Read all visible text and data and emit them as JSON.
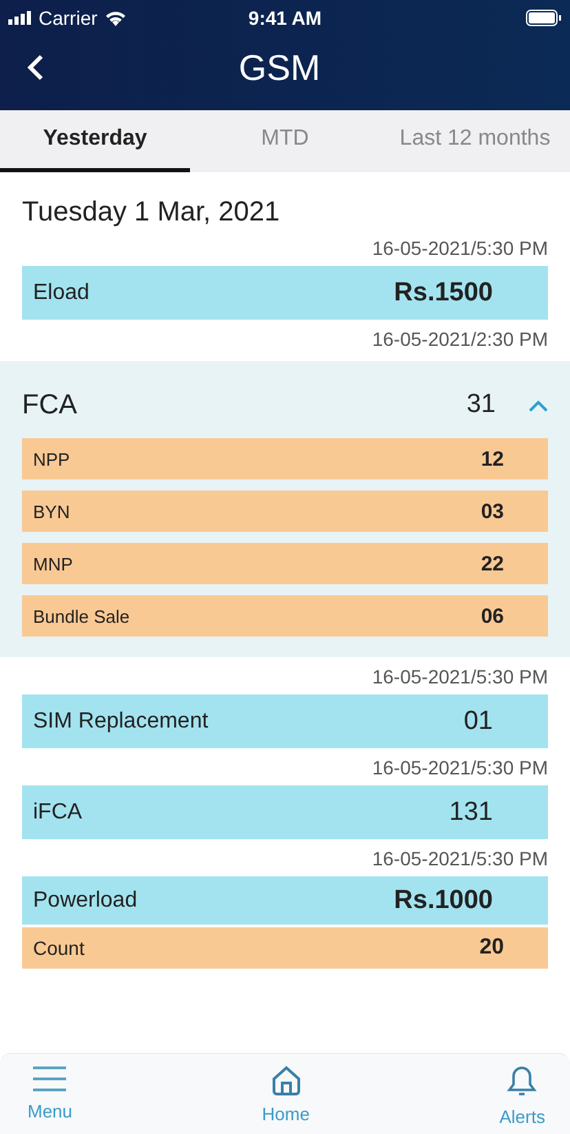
{
  "status_bar": {
    "carrier": "Carrier",
    "time": "9:41 AM"
  },
  "header": {
    "title": "GSM"
  },
  "tabs": [
    {
      "label": "Yesterday",
      "selected": true
    },
    {
      "label": "MTD",
      "selected": false
    },
    {
      "label": "Last 12 months",
      "selected": false
    }
  ],
  "date": "Tuesday 1 Mar, 2021",
  "blocks": [
    {
      "kind": "stamp",
      "text": "16-05-2021/5:30 PM"
    },
    {
      "kind": "item",
      "bold": true,
      "label": "Eload",
      "value": "Rs.1500"
    },
    {
      "kind": "stamp",
      "text": "16-05-2021/2:30 PM"
    },
    {
      "kind": "group",
      "label": "FCA",
      "value": "31",
      "expanded": true,
      "children": [
        {
          "label": "NPP",
          "value": "12"
        },
        {
          "label": "BYN",
          "value": "03"
        },
        {
          "label": "MNP",
          "value": "22"
        },
        {
          "label": "Bundle Sale",
          "value": "06"
        }
      ]
    },
    {
      "kind": "stamp",
      "text": "16-05-2021/5:30 PM"
    },
    {
      "kind": "item",
      "bold": false,
      "label": "SIM Replacement",
      "value": "01"
    },
    {
      "kind": "stamp",
      "text": "16-05-2021/5:30 PM"
    },
    {
      "kind": "item",
      "bold": false,
      "label": "iFCA",
      "value": "131"
    },
    {
      "kind": "stamp",
      "text": "16-05-2021/5:30 PM"
    },
    {
      "kind": "item",
      "bold": true,
      "label": "Powerload",
      "value": "Rs.1000"
    },
    {
      "kind": "subitem",
      "bold": true,
      "label": "Count",
      "value": "20"
    }
  ],
  "nav": [
    {
      "label": "Menu"
    },
    {
      "label": "Home"
    },
    {
      "label": "Alerts"
    }
  ]
}
